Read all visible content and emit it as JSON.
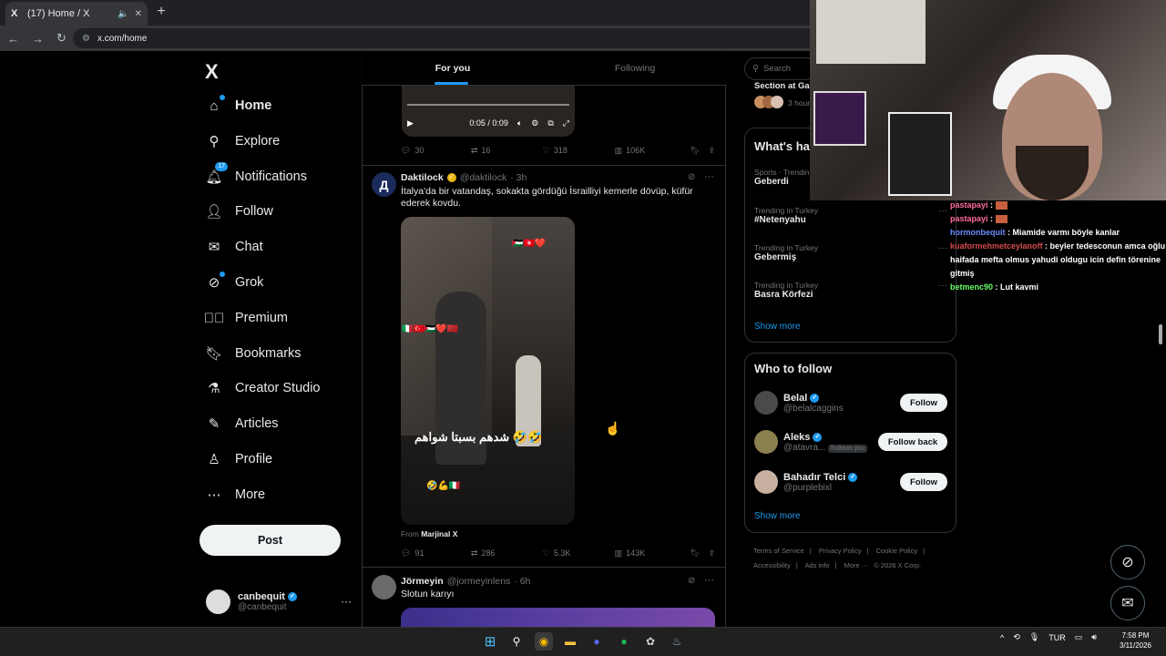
{
  "browser": {
    "tab_title": "(17) Home / X",
    "url": "x.com/home",
    "tab_favicon": "X"
  },
  "sidebar": {
    "logo": "X",
    "items": [
      {
        "label": "Home",
        "icon": "home-icon"
      },
      {
        "label": "Explore",
        "icon": "search-icon"
      },
      {
        "label": "Notifications",
        "icon": "bell-icon",
        "badge": "17"
      },
      {
        "label": "Follow",
        "icon": "person-plus-icon"
      },
      {
        "label": "Chat",
        "icon": "mail-icon"
      },
      {
        "label": "Grok",
        "icon": "grok-icon"
      },
      {
        "label": "Premium",
        "icon": "premium-icon"
      },
      {
        "label": "Bookmarks",
        "icon": "bookmark-icon"
      },
      {
        "label": "Creator Studio",
        "icon": "flask-icon"
      },
      {
        "label": "Articles",
        "icon": "article-icon"
      },
      {
        "label": "Profile",
        "icon": "person-icon"
      },
      {
        "label": "More",
        "icon": "more-circle-icon"
      }
    ],
    "post_button": "Post",
    "account": {
      "name": "canbequit",
      "handle": "@canbequit",
      "more": "···"
    }
  },
  "timeline": {
    "tabs": [
      "For you",
      "Following"
    ],
    "video1": {
      "time": "0:05 / 0:09"
    },
    "tweet0_actions": {
      "replies": "30",
      "reposts": "16",
      "likes": "318",
      "views": "106K"
    },
    "tweet1": {
      "name": "Daktilock",
      "handle": "@daktilock",
      "time": "· 3h",
      "avatar_letter": "Д",
      "text": "İtalya'da bir vatandaş, sokakta gördüğü İsrailliyi kemerle dövüp, küfür ederek kovdu.",
      "video_caption": "شدهم بسبتا شواهم 🤣🤣",
      "from_label": "From",
      "from_source": "Marjinal X",
      "actions": {
        "replies": "91",
        "reposts": "286",
        "likes": "5.3K",
        "views": "143K"
      }
    },
    "tweet2": {
      "name": "Jörmeyin",
      "handle": "@jormeyinlens",
      "time": "· 6h",
      "text": "Slotun karıyı"
    }
  },
  "right": {
    "search_placeholder": "Search",
    "spaces_title": "Section at Ga",
    "spaces_time": "3 hour",
    "happening": {
      "title": "What's ha",
      "trends": [
        {
          "meta": "Sports · Trendin",
          "name": "Geberdi"
        },
        {
          "meta": "Trending in Turkey",
          "name": "#Netenyahu"
        },
        {
          "meta": "Trending in Turkey",
          "name": "Gebermiş"
        },
        {
          "meta": "Trending in Turkey",
          "name": "Basra Körfezi"
        }
      ],
      "show_more": "Show more"
    },
    "who_to_follow": {
      "title": "Who to follow",
      "users": [
        {
          "name": "Belal",
          "handle": "@belalcaggins",
          "button": "Follow",
          "follows_you": ""
        },
        {
          "name": "Aleks",
          "handle": "@atavra...",
          "button": "Follow back",
          "follows_you": "Follows you"
        },
        {
          "name": "Bahadır Telci",
          "handle": "@purplebixl",
          "button": "Follow",
          "follows_you": ""
        }
      ],
      "show_more": "Show more"
    },
    "footer": [
      "Terms of Service",
      "|",
      "Privacy Policy",
      "|",
      "Cookie Policy",
      "|",
      "Accessibility",
      "|",
      "Ads info",
      "|",
      "More ···",
      "© 2026 X Corp."
    ]
  },
  "stream_chat": [
    {
      "user": "pastapayi",
      "msg": "",
      "color": "#ff6b9d"
    },
    {
      "user": "pastapayi",
      "msg": "",
      "color": "#ff6b9d"
    },
    {
      "user": "hormonbequit",
      "msg": "Miamide varmı böyle kanlar",
      "color": "#6b8cff"
    },
    {
      "user": "kuaformehmetceylanoff",
      "msg": "beyler tedesconun amca oğlu haifada mefta olmus yahudi oldugu icin defin törenine gitmiş",
      "color": "#d44b4b"
    },
    {
      "user": "betmenc90",
      "msg": "Lut kavmi",
      "color": "#6bff6b"
    }
  ],
  "taskbar": {
    "lang": "TUR",
    "time": "7:58 PM",
    "date": "3/11/2026"
  }
}
